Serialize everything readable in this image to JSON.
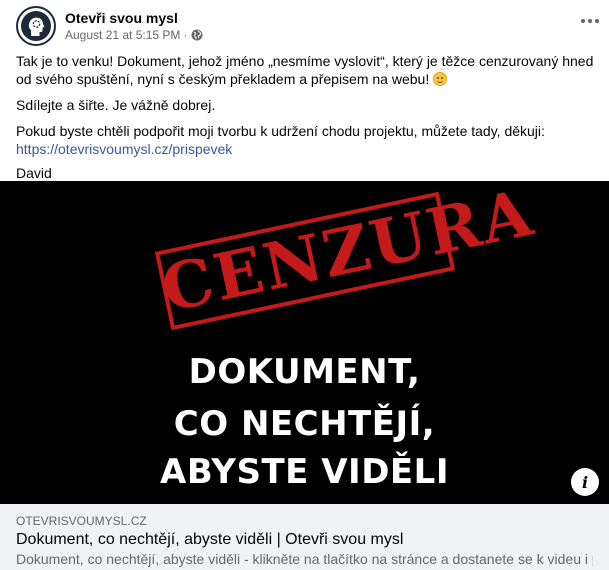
{
  "post": {
    "author": "Otevři svou mysl",
    "timestamp": "August 21 at 5:15 PM",
    "separator": "·",
    "paragraphs": [
      "Tak je to venku! Dokument, jehož jméno „nesmíme vyslovit“, který je těžce cenzurovaný hned od svého spuštění, nyní s českým překladem a přepisem na webu!",
      "Sdílejte a šiřte. Je vážně dobrej.",
      "Pokud byste chtěli podpořit moji tvorbu k udržení chodu projektu, můžete tady, děkuji:"
    ],
    "support_link": "https://otevrisvoumysl.cz/prispevek",
    "signature": "David",
    "icons": {
      "more": "more-horizontal-icon",
      "privacy": "globe-icon",
      "emoji": "smiley-emoji-icon",
      "info": "info-icon"
    }
  },
  "banner": {
    "stamp_text": "CENZURA",
    "headline_lines": [
      "DOKUMENT,",
      "CO NECHTĚJÍ,",
      "ABYSTE VIDĚLI"
    ],
    "colors": {
      "background": "#000000",
      "stamp": "#c41a1a",
      "headline": "#ffffff"
    }
  },
  "link_preview": {
    "domain": "OTEVRISVOUMYSL.CZ",
    "title": "Dokument, co nechtějí, abyste viděli | Otevři svou mysl",
    "description": "Dokument, co nechtějí, abyste viděli - klikněte na tlačítko na stránce a dostanete se k videu i p..."
  }
}
